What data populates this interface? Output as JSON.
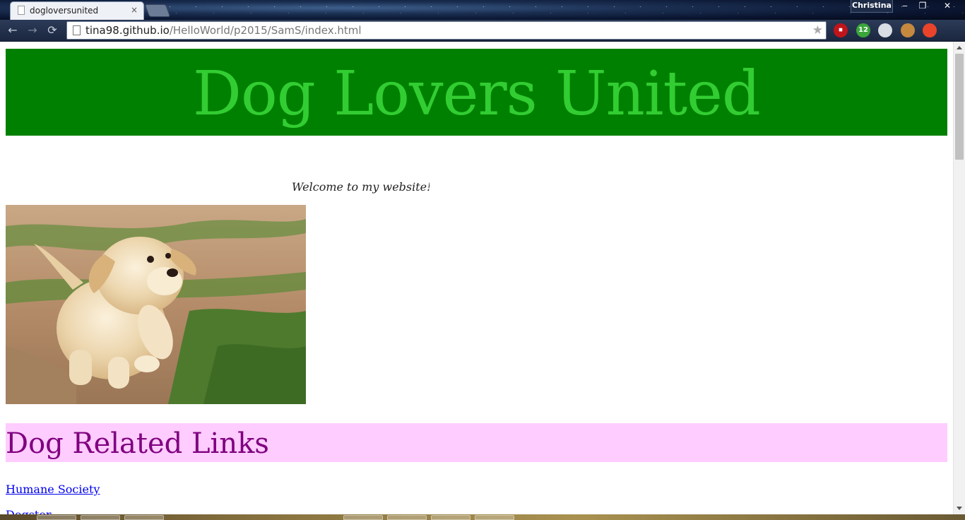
{
  "browser": {
    "tab_title": "dogloversunited",
    "tab_close": "×",
    "profile_name": "Christina",
    "window_buttons": {
      "minimize": "‒",
      "restore": "❐",
      "close": "✕"
    },
    "nav": {
      "back": "←",
      "forward": "→",
      "reload": "⟳"
    },
    "url_host": "tina98.github.io",
    "url_path": "/HelloWorld/p2015/SamS/index.html",
    "bookmark_star": "★",
    "extensions": [
      {
        "name": "stop-icon",
        "label": "⏹",
        "color": "#c0141b"
      },
      {
        "name": "update-badge-icon",
        "label": "12",
        "color": "#3aa53a"
      },
      {
        "name": "balloon-icon",
        "label": "",
        "color": "#d9dde4"
      },
      {
        "name": "cookie-icon",
        "label": "",
        "color": "#c4893f"
      },
      {
        "name": "chrome-icon",
        "label": "",
        "color": "#e9442b"
      }
    ],
    "menu_icon": "≡"
  },
  "page": {
    "site_title": "Dog Lovers United",
    "welcome_text": "Welcome to my website! D",
    "links_heading": "Dog Related Links",
    "links": [
      "Humane Society",
      "Dogster"
    ],
    "colors": {
      "header_bg": "#008000",
      "title_color": "#32cd32",
      "links_bg": "#ffccff",
      "links_heading_color": "#800080"
    }
  }
}
